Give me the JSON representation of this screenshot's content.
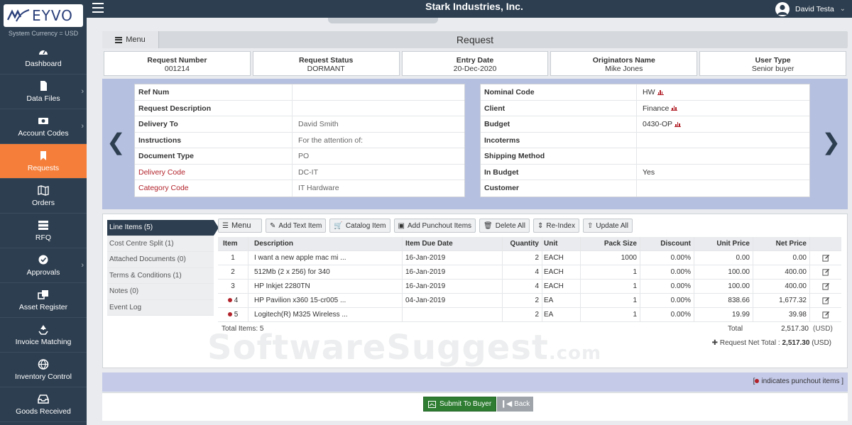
{
  "app": {
    "logo_text": "EYVO",
    "currency_label": "System Currency =  USD",
    "company": "Stark Industries, Inc.",
    "user": "David Testa"
  },
  "sidebar": {
    "items": [
      {
        "label": "Dashboard",
        "icon": "gauge-icon",
        "has_chevron": false,
        "active": false
      },
      {
        "label": "Data Files",
        "icon": "file-icon",
        "has_chevron": true,
        "active": false
      },
      {
        "label": "Account Codes",
        "icon": "money-icon",
        "has_chevron": true,
        "active": false
      },
      {
        "label": "Requests",
        "icon": "bookmark-icon",
        "has_chevron": false,
        "active": true
      },
      {
        "label": "Orders",
        "icon": "map-icon",
        "has_chevron": false,
        "active": false
      },
      {
        "label": "RFQ",
        "icon": "server-icon",
        "has_chevron": false,
        "active": false
      },
      {
        "label": "Approvals",
        "icon": "approval-icon",
        "has_chevron": true,
        "active": false
      },
      {
        "label": "Asset Register",
        "icon": "clone-icon",
        "has_chevron": false,
        "active": false
      },
      {
        "label": "Invoice Matching",
        "icon": "recycle-icon",
        "has_chevron": false,
        "active": false
      },
      {
        "label": "Inventory Control",
        "icon": "globe-icon",
        "has_chevron": false,
        "active": false
      },
      {
        "label": "Goods Received",
        "icon": "inbox-icon",
        "has_chevron": false,
        "active": false
      }
    ],
    "active_color": "#f57f3a"
  },
  "page": {
    "menu_label": "Menu",
    "title": "Request"
  },
  "summary": [
    {
      "label": "Request Number",
      "value": "001214"
    },
    {
      "label": "Request Status",
      "value": "DORMANT"
    },
    {
      "label": "Entry Date",
      "value": "20-Dec-2020"
    },
    {
      "label": "Originators Name",
      "value": "Mike Jones"
    },
    {
      "label": "User Type",
      "value": "Senior buyer"
    }
  ],
  "details_left": [
    {
      "label": "Ref Num",
      "value": "",
      "red": false
    },
    {
      "label": "Request Description",
      "value": "",
      "red": false
    },
    {
      "label": "Delivery To",
      "value": "David Smith",
      "red": false
    },
    {
      "label": "Instructions",
      "value": "For the attention of:",
      "red": false
    },
    {
      "label": "Document Type",
      "value": "PO",
      "red": false
    },
    {
      "label": "Delivery Code",
      "value": "DC-IT",
      "red": true
    },
    {
      "label": "Category Code",
      "value": "IT Hardware",
      "red": true
    }
  ],
  "details_right": [
    {
      "label": "Nominal Code",
      "value": "HW",
      "chart": true
    },
    {
      "label": "Client",
      "value": "Finance",
      "chart": true
    },
    {
      "label": "Budget",
      "value": "0430-OP",
      "chart": true
    },
    {
      "label": "Incoterms",
      "value": "",
      "chart": false
    },
    {
      "label": "Shipping Method",
      "value": "",
      "chart": false
    },
    {
      "label": "In Budget",
      "value": "Yes",
      "chart": false
    },
    {
      "label": "Customer",
      "value": "",
      "chart": false
    }
  ],
  "side_tabs": [
    {
      "label": "Line Items (5)",
      "active": true
    },
    {
      "label": "Cost Centre Split (1)",
      "active": false
    },
    {
      "label": "Attached Documents (0)",
      "active": false
    },
    {
      "label": "Terms & Conditions (1)",
      "active": false
    },
    {
      "label": "Notes (0)",
      "active": false
    },
    {
      "label": "Event Log",
      "active": false
    }
  ],
  "toolbar": [
    {
      "label": "Menu",
      "icon": "bars-icon"
    },
    {
      "label": "Add Text Item",
      "icon": "edit-icon"
    },
    {
      "label": "Catalog Item",
      "icon": "cart-icon"
    },
    {
      "label": "Add Punchout Items",
      "icon": "card-icon"
    },
    {
      "label": "Delete All",
      "icon": "trash-icon"
    },
    {
      "label": "Re-Index",
      "icon": "sort-icon"
    },
    {
      "label": "Update All",
      "icon": "upload-icon"
    }
  ],
  "grid": {
    "headers": {
      "item": "Item",
      "desc": "Description",
      "due": "Item Due Date",
      "qty": "Quantity",
      "unit": "Unit",
      "pack": "Pack Size",
      "disc": "Discount",
      "uprice": "Unit Price",
      "nprice": "Net Price"
    },
    "rows": [
      {
        "item": "1",
        "punchout": false,
        "desc": "I want a new apple mac mi ...",
        "due": "16-Jan-2019",
        "qty": "2",
        "unit": "EACH",
        "pack": "1000",
        "disc": "0.00%",
        "uprice": "0.00",
        "nprice": "0.00"
      },
      {
        "item": "2",
        "punchout": false,
        "desc": "512Mb (2 x 256) for 340",
        "due": "16-Jan-2019",
        "qty": "4",
        "unit": "EACH",
        "pack": "1",
        "disc": "0.00%",
        "uprice": "100.00",
        "nprice": "400.00"
      },
      {
        "item": "3",
        "punchout": false,
        "desc": "HP Inkjet 2280TN",
        "due": "16-Jan-2019",
        "qty": "4",
        "unit": "EACH",
        "pack": "1",
        "disc": "0.00%",
        "uprice": "100.00",
        "nprice": "400.00"
      },
      {
        "item": "4",
        "punchout": true,
        "desc": "HP Pavilion x360 15-cr005 ...",
        "due": "04-Jan-2019",
        "qty": "2",
        "unit": "EA",
        "pack": "1",
        "disc": "0.00%",
        "uprice": "838.66",
        "nprice": "1,677.32"
      },
      {
        "item": "5",
        "punchout": true,
        "desc": "Logitech(R) M325 Wireless ...",
        "due": "",
        "qty": "2",
        "unit": "EA",
        "pack": "1",
        "disc": "0.00%",
        "uprice": "19.99",
        "nprice": "39.98"
      }
    ],
    "total_items": "Total Items: 5",
    "total_label": "Total",
    "total_value": "2,517.30",
    "currency": "(USD)",
    "net_label": "Request Net Total :",
    "net_value": "2,517.30",
    "net_currency": "(USD)"
  },
  "watermark": {
    "main": "SoftwareSuggest",
    "suffix": ".com"
  },
  "legend": "indicates punchout items ]",
  "legend_prefix": "[",
  "actions": {
    "submit": "Submit To Buyer",
    "back": "Back"
  }
}
